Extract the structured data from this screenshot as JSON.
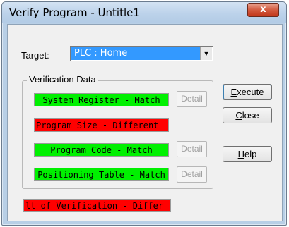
{
  "window": {
    "title": "Verify Program - Untitle1",
    "close_label": "x"
  },
  "target": {
    "label": "Target:",
    "value": "PLC  :  Home",
    "arrow": "▼"
  },
  "verification": {
    "group_label": "Verification Data",
    "rows": [
      {
        "text": "System Register - Match",
        "status": "match",
        "color": "#00f000",
        "detail": "Detail"
      },
      {
        "text": "Program Size - Different",
        "status": "different",
        "color": "#ff0000"
      },
      {
        "text": "Program Code - Match",
        "status": "match",
        "color": "#00f000",
        "detail": "Detail"
      },
      {
        "text": "Positioning Table - Match",
        "status": "match",
        "color": "#00f000",
        "detail": "Detail"
      }
    ]
  },
  "result_text": "lt of Verification - Differ",
  "buttons": {
    "execute_first": "E",
    "execute_rest": "xecute",
    "close_first": "C",
    "close_rest": "lose",
    "help_first": "H",
    "help_rest": "elp"
  },
  "colors": {
    "match": "#00f000",
    "different": "#ff0000",
    "selection": "#3399ff"
  }
}
